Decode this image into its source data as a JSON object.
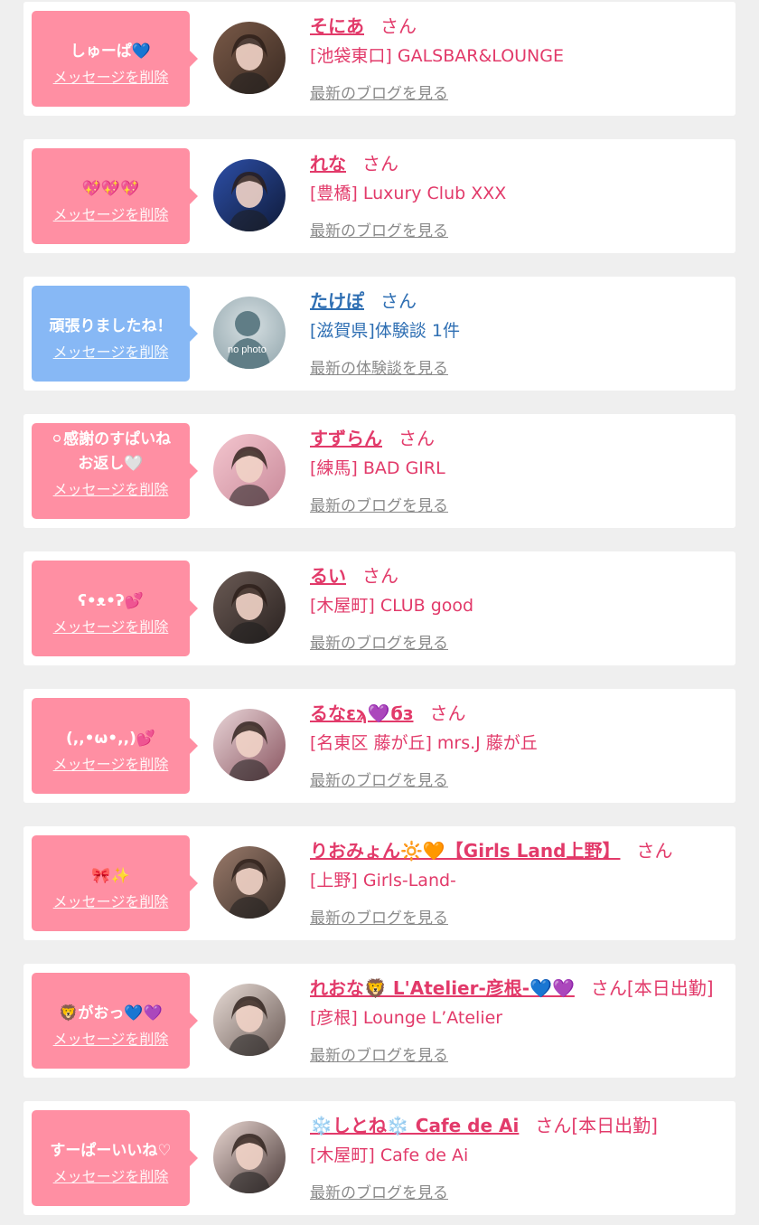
{
  "colors": {
    "pink_bubble": "#ff8fa3",
    "blue_bubble": "#87b8f5",
    "pink_text": "#e23a6a",
    "blue_text": "#2f6fb3",
    "link_gray": "#8a8a8a",
    "background": "#efefef"
  },
  "cards": [
    {
      "theme": "pink",
      "message": "しゅーぱ💙",
      "delete_label": "メッセージを削除",
      "name": "そにあ",
      "honorific": "さん",
      "status": "",
      "shop": "[池袋東口] GALSBAR&LOUNGE",
      "link": "最新のブログを見る",
      "avatar": "photo-avatar"
    },
    {
      "theme": "pink",
      "message": "💖💖💖",
      "delete_label": "メッセージを削除",
      "name": "れな",
      "honorific": "さん",
      "status": "",
      "shop": "[豊橋] Luxury Club XXX",
      "link": "最新のブログを見る",
      "avatar": "photo-avatar"
    },
    {
      "theme": "blue",
      "message": "頑張りましたね！",
      "delete_label": "メッセージを削除",
      "name": "たけぽ",
      "honorific": "さん",
      "status": "",
      "shop": "[滋賀県]体験談 1件",
      "link": "最新の体験談を見る",
      "avatar": "no-photo-avatar",
      "avatar_text": "no photo"
    },
    {
      "theme": "pink",
      "message": "⚪感謝のすぱいね\nお返し🤍",
      "delete_label": "メッセージを削除",
      "name": "すずらん",
      "honorific": "さん",
      "status": "",
      "shop": "[練馬] BAD GIRL",
      "link": "最新のブログを見る",
      "avatar": "photo-avatar"
    },
    {
      "theme": "pink",
      "message": "ʕ•ᴥ•ʔ💕",
      "delete_label": "メッセージを削除",
      "name": "るい",
      "honorific": "さん",
      "status": "",
      "shop": "[木屋町] CLUB good",
      "link": "最新のブログを見る",
      "avatar": "photo-avatar"
    },
    {
      "theme": "pink",
      "message": "(,,•ω•,,)💕",
      "delete_label": "メッセージを削除",
      "name": "るなεϡ💜ϭз",
      "honorific": "さん",
      "status": "",
      "shop": "[名東区 藤が丘] mrs.J 藤が丘",
      "link": "最新のブログを見る",
      "avatar": "photo-avatar"
    },
    {
      "theme": "pink",
      "message": "🎀✨",
      "delete_label": "メッセージを削除",
      "name": "りおみょん🔆🧡【Girls Land上野】",
      "honorific": "さん",
      "status": "",
      "shop": "[上野] Girls-Land-",
      "link": "最新のブログを見る",
      "avatar": "photo-avatar"
    },
    {
      "theme": "pink",
      "message": "🦁がおっ💙💜",
      "delete_label": "メッセージを削除",
      "name": "れおな🦁 L'Atelier-彦根-💙💜",
      "honorific": "さん",
      "status": "[本日出勤]",
      "shop": "[彦根] Lounge L’Atelier",
      "link": "最新のブログを見る",
      "avatar": "photo-avatar"
    },
    {
      "theme": "pink",
      "message": "すーぱーいいね♡",
      "delete_label": "メッセージを削除",
      "name": "❄️しとね❄️ Cafe de Ai",
      "honorific": "さん",
      "status": "[本日出勤]",
      "shop": "[木屋町] Cafe de Ai",
      "link": "最新のブログを見る",
      "avatar": "photo-avatar"
    }
  ]
}
